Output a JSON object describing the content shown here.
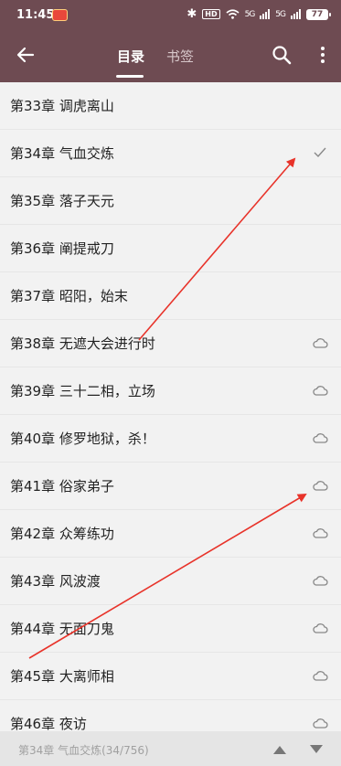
{
  "status_bar": {
    "time": "11:45",
    "hd": "HD",
    "signal_1": "5G",
    "signal_2": "5G",
    "battery": "77"
  },
  "toolbar": {
    "tabs": [
      {
        "label": "目录",
        "active": true
      },
      {
        "label": "书签",
        "active": false
      }
    ],
    "icons": [
      "back-arrow-icon",
      "search-icon",
      "more-vert-icon"
    ]
  },
  "chapters": [
    {
      "title": "第33章 调虎离山",
      "status": "none"
    },
    {
      "title": "第34章 气血交炼",
      "status": "current"
    },
    {
      "title": "第35章 落子天元",
      "status": "none"
    },
    {
      "title": "第36章 阐提戒刀",
      "status": "none"
    },
    {
      "title": "第37章 昭阳，始末",
      "status": "none"
    },
    {
      "title": "第38章 无遮大会进行时",
      "status": "cloud"
    },
    {
      "title": "第39章 三十二相，立场",
      "status": "cloud"
    },
    {
      "title": "第40章 修罗地狱，杀！",
      "status": "cloud"
    },
    {
      "title": "第41章 俗家弟子",
      "status": "cloud"
    },
    {
      "title": "第42章 众筹练功",
      "status": "cloud"
    },
    {
      "title": "第43章 风波渡",
      "status": "cloud"
    },
    {
      "title": "第44章 无面刀鬼",
      "status": "cloud"
    },
    {
      "title": "第45章 大离师相",
      "status": "cloud"
    },
    {
      "title": "第46章 夜访",
      "status": "cloud"
    }
  ],
  "bottom_bar": {
    "progress": "第34章 气血交炼(34/756)"
  },
  "colors": {
    "header": "#6e4b52",
    "annotation_arrow": "#e8332a"
  }
}
